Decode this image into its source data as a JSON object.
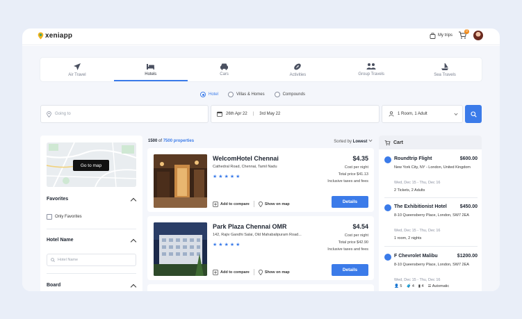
{
  "brand": {
    "name": "xeniapp"
  },
  "topbar": {
    "my_trips": "My trips",
    "cart_count": "0"
  },
  "tabs": [
    {
      "label": "Air Travel",
      "icon": "airplane-icon"
    },
    {
      "label": "Hotels",
      "icon": "bed-icon"
    },
    {
      "label": "Cars",
      "icon": "car-icon"
    },
    {
      "label": "Activities",
      "icon": "ball-icon"
    },
    {
      "label": "Group Travels",
      "icon": "group-icon"
    },
    {
      "label": "Sea Travels",
      "icon": "boat-icon"
    }
  ],
  "search": {
    "types": [
      "Hotel",
      "Villas & Homes",
      "Compounds"
    ],
    "selected_type": "Hotel",
    "going_to_placeholder": "Going to",
    "date_from": "26th Apr 22",
    "date_to": "3rd May 22",
    "rooms": "1 Room, 1 Adult"
  },
  "filters": {
    "map_button": "Go to map",
    "favorites_title": "Favorites",
    "only_favorites": "Only Favorites",
    "hotel_name_title": "Hotel Name",
    "hotel_name_placeholder": "Hotel Name",
    "board_title": "Board"
  },
  "results": {
    "shown": "1500",
    "of": "of",
    "total": "7500 properties",
    "sorted_by_label": "Sorted by",
    "sorted_by_value": "Lowest",
    "add_to_compare": "Add to compare",
    "show_on_map": "Show on map",
    "details_label": "Details",
    "cost_per_night_label": "Cost per night",
    "taxes_label": "Inclusive taxes and fees",
    "hotels": [
      {
        "name": "WelcomHotel Chennai",
        "address": "Cathedral Road, Chennai, Tamil Nadu",
        "stars": 5,
        "price": "$4.35",
        "total": "Total price $41.13"
      },
      {
        "name": "Park Plaza Chennai OMR",
        "address": "142, Rajiv Gandhi Salai, Old Mahabalipuram Road...",
        "stars": 5,
        "price": "$4.54",
        "total": "Total price $42.90"
      }
    ]
  },
  "cart": {
    "title": "Cart",
    "items": [
      {
        "title": "Roundtrip Flight",
        "price": "$600.00",
        "location": "New York City, NY - London, United Kingdom",
        "dates": "Wed, Dec 15 - Thu, Dec 16",
        "detail": "2 Tickets, 2 Adults",
        "icon": "airplane-icon"
      },
      {
        "title": "The Exhibitionist Hotel",
        "price": "$450.00",
        "location": "8-10 Queensberry Place, London, SW7 2EA",
        "dates": "Wed, Dec 15 - Thu, Dec 16",
        "detail": "1 room, 2 nights",
        "icon": "bed-icon"
      },
      {
        "title": "F Chevrolet Malibu",
        "price": "$1200.00",
        "location": "8-10 Queensberry Place, London, SW7 2EA",
        "dates": "Wed, Dec 15 - Thu, Dec 16",
        "icon": "car-icon",
        "specs": {
          "seats": "5",
          "bags": "4",
          "doors": "4",
          "transmission": "Automatic"
        }
      }
    ]
  },
  "colors": {
    "accent": "#3b7be9",
    "badge": "#f28c1c"
  }
}
